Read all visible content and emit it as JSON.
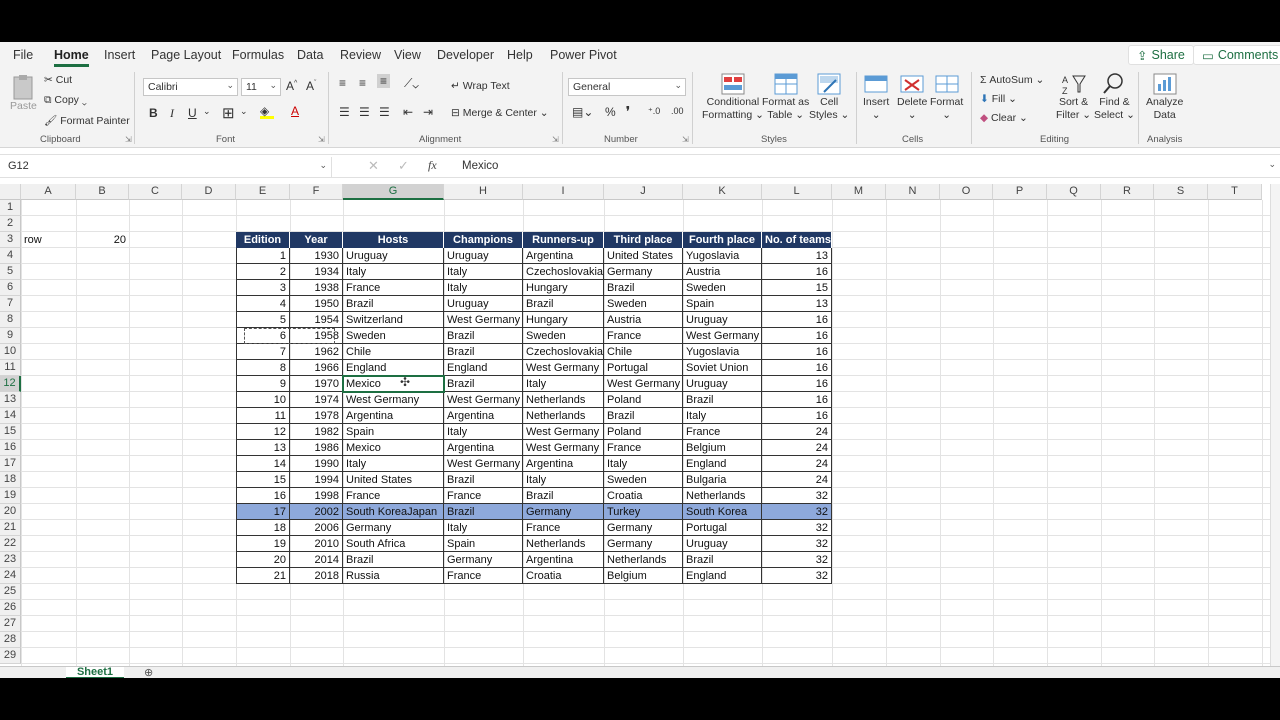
{
  "tabs": [
    "File",
    "Home",
    "Insert",
    "Page Layout",
    "Formulas",
    "Data",
    "Review",
    "View",
    "Developer",
    "Help",
    "Power Pivot"
  ],
  "share_label": "Share",
  "comments_label": "Comments",
  "clipboard": {
    "paste": "Paste",
    "cut": "Cut",
    "copy": "Copy",
    "format_painter": "Format Painter",
    "label": "Clipboard"
  },
  "font": {
    "name": "Calibri",
    "size": "11",
    "label": "Font",
    "bold": "B",
    "italic": "I",
    "underline": "U"
  },
  "alignment": {
    "wrap": "Wrap Text",
    "merge": "Merge & Center",
    "label": "Alignment"
  },
  "number": {
    "format": "General",
    "label": "Number"
  },
  "styles": {
    "conditional": "Conditional",
    "formatting": "Formatting",
    "format_as": "Format as",
    "table": "Table",
    "cell": "Cell",
    "cell_styles": "Styles",
    "label": "Styles"
  },
  "cells": {
    "insert": "Insert",
    "delete": "Delete",
    "format": "Format",
    "label": "Cells"
  },
  "editing": {
    "autosum": "AutoSum",
    "fill": "Fill",
    "clear": "Clear",
    "sort": "Sort &",
    "filter": "Filter",
    "find": "Find &",
    "select": "Select",
    "label": "Editing"
  },
  "analysis": {
    "analyze": "Analyze",
    "data": "Data",
    "label": "Analysis"
  },
  "namebox": "G12",
  "formula": "Mexico",
  "fx": "fx",
  "columns": [
    "A",
    "B",
    "C",
    "D",
    "E",
    "F",
    "G",
    "H",
    "I",
    "J",
    "K",
    "L",
    "M",
    "N",
    "O",
    "P",
    "Q",
    "R",
    "S",
    "T"
  ],
  "rows": [
    "1",
    "2",
    "3",
    "4",
    "5",
    "6",
    "7",
    "8",
    "9",
    "10",
    "11",
    "12",
    "13",
    "14",
    "15",
    "16",
    "17",
    "18",
    "19",
    "20",
    "21",
    "22",
    "23",
    "24",
    "25",
    "26",
    "27",
    "28",
    "29"
  ],
  "a3": "row",
  "b3": "20",
  "table": {
    "headers": [
      "Edition",
      "Year",
      "Hosts",
      "Champions",
      "Runners-up",
      "Third place",
      "Fourth place",
      "No. of teams"
    ],
    "rows": [
      [
        "1",
        "1930",
        "Uruguay",
        "Uruguay",
        "Argentina",
        "United States",
        "Yugoslavia",
        "13"
      ],
      [
        "2",
        "1934",
        "Italy",
        "Italy",
        "Czechoslovakia",
        "Germany",
        "Austria",
        "16"
      ],
      [
        "3",
        "1938",
        "France",
        "Italy",
        "Hungary",
        "Brazil",
        "Sweden",
        "15"
      ],
      [
        "4",
        "1950",
        "Brazil",
        "Uruguay",
        "Brazil",
        "Sweden",
        "Spain",
        "13"
      ],
      [
        "5",
        "1954",
        "Switzerland",
        "West Germany",
        "Hungary",
        "Austria",
        "Uruguay",
        "16"
      ],
      [
        "6",
        "1958",
        "Sweden",
        "Brazil",
        "Sweden",
        "France",
        "West Germany",
        "16"
      ],
      [
        "7",
        "1962",
        "Chile",
        "Brazil",
        "Czechoslovakia",
        "Chile",
        "Yugoslavia",
        "16"
      ],
      [
        "8",
        "1966",
        "England",
        "England",
        "West Germany",
        "Portugal",
        "Soviet Union",
        "16"
      ],
      [
        "9",
        "1970",
        "Mexico",
        "Brazil",
        "Italy",
        "West Germany",
        "Uruguay",
        "16"
      ],
      [
        "10",
        "1974",
        "West Germany",
        "West Germany",
        "Netherlands",
        "Poland",
        "Brazil",
        "16"
      ],
      [
        "11",
        "1978",
        "Argentina",
        "Argentina",
        "Netherlands",
        "Brazil",
        "Italy",
        "16"
      ],
      [
        "12",
        "1982",
        "Spain",
        "Italy",
        "West Germany",
        "Poland",
        "France",
        "24"
      ],
      [
        "13",
        "1986",
        "Mexico",
        "Argentina",
        "West Germany",
        "France",
        "Belgium",
        "24"
      ],
      [
        "14",
        "1990",
        "Italy",
        "West Germany",
        "Argentina",
        "Italy",
        "England",
        "24"
      ],
      [
        "15",
        "1994",
        "United States",
        "Brazil",
        "Italy",
        "Sweden",
        "Bulgaria",
        "24"
      ],
      [
        "16",
        "1998",
        "France",
        "France",
        "Brazil",
        "Croatia",
        "Netherlands",
        "32"
      ],
      [
        "17",
        "2002",
        "South KoreaJapan",
        "Brazil",
        "Germany",
        "Turkey",
        "South Korea",
        "32"
      ],
      [
        "18",
        "2006",
        "Germany",
        "Italy",
        "France",
        "Germany",
        "Portugal",
        "32"
      ],
      [
        "19",
        "2010",
        "South Africa",
        "Spain",
        "Netherlands",
        "Germany",
        "Uruguay",
        "32"
      ],
      [
        "20",
        "2014",
        "Brazil",
        "Germany",
        "Argentina",
        "Netherlands",
        "Brazil",
        "32"
      ],
      [
        "21",
        "2018",
        "Russia",
        "France",
        "Croatia",
        "Belgium",
        "England",
        "32"
      ]
    ]
  },
  "sheet_tab": "Sheet1",
  "colors": {
    "accent": "#1d6f42",
    "table_header": "#203864",
    "highlight_row": "#8ea9db"
  }
}
